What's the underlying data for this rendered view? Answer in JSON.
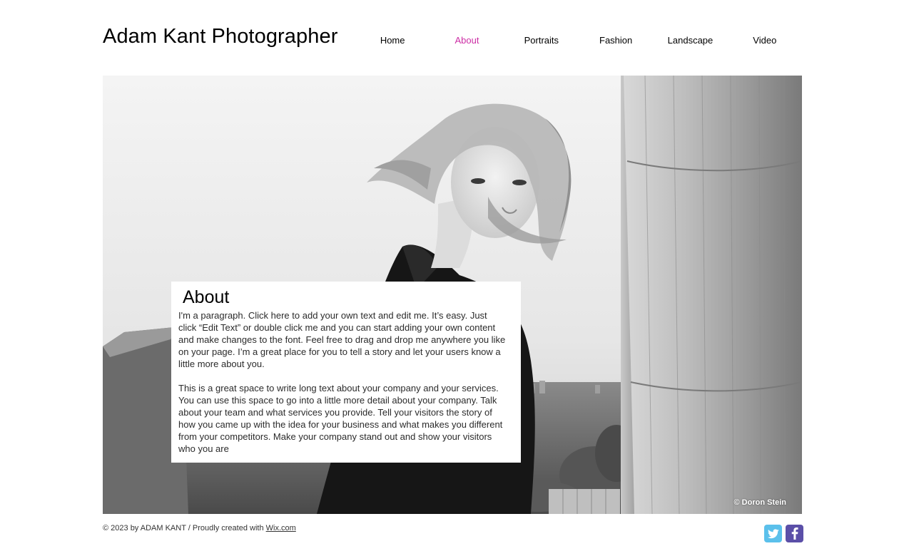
{
  "header": {
    "site_title": "Adam Kant Photographer",
    "nav": [
      {
        "label": "Home",
        "active": false
      },
      {
        "label": "About",
        "active": true
      },
      {
        "label": "Portraits",
        "active": false
      },
      {
        "label": "Fashion",
        "active": false
      },
      {
        "label": "Landscape",
        "active": false
      },
      {
        "label": "Video",
        "active": false
      }
    ]
  },
  "about": {
    "title": "About",
    "paragraph_1": "I'm a paragraph. Click here to add your own text and edit me. It’s easy. Just click “Edit Text” or double click me and you can start adding your own content and make changes to the font. Feel free to drag and drop me anywhere you like on your page. I’m a great place for you to tell a story and let your users know a little more about you.",
    "paragraph_2": "This is a great space to write long text about your company and your services. You can use this space to go into a little more detail about your company. Talk about your team and what services you provide. Tell your visitors the story of how you came up with the idea for your business and what makes you different from your competitors. Make your company stand out and show your visitors who you are"
  },
  "hero": {
    "photo_credit": "© Doron Stein"
  },
  "footer": {
    "copyright_prefix": "© 2023 by ADAM KANT / Proudly created with ",
    "link_label": "Wix.com"
  },
  "social": [
    {
      "name": "twitter-icon",
      "color": "#5bc0eb"
    },
    {
      "name": "facebook-icon",
      "color": "#5b4fa8"
    }
  ],
  "colors": {
    "accent": "#cc2ea5"
  }
}
